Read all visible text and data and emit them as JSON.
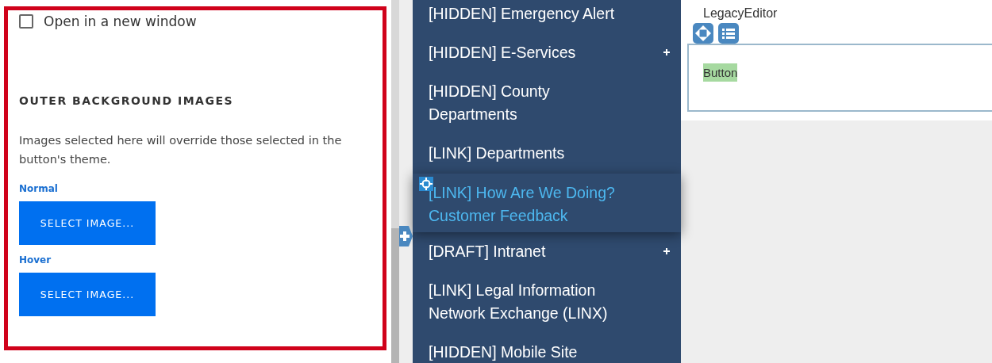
{
  "settings_panel": {
    "open_in_new_window": {
      "label": "Open in a new window",
      "checked": false
    },
    "section_title": "OUTER BACKGROUND IMAGES",
    "description": "Images selected here will override those selected in the button's theme.",
    "image_fields": [
      {
        "label": "Normal",
        "button": "SELECT IMAGE..."
      },
      {
        "label": "Hover",
        "button": "SELECT IMAGE..."
      }
    ]
  },
  "nav_menu": {
    "items": [
      {
        "label": "[HIDDEN] Emergency Alert",
        "has_children": false,
        "selected": false
      },
      {
        "label": "[HIDDEN] E-Services",
        "has_children": true,
        "selected": false
      },
      {
        "label": "[HIDDEN] County Departments",
        "has_children": false,
        "selected": false
      },
      {
        "label": "[LINK] Departments",
        "has_children": false,
        "selected": false
      },
      {
        "label": "[LINK] How Are We Doing? Customer Feedback",
        "has_children": false,
        "selected": true
      },
      {
        "label": "[DRAFT] Intranet",
        "has_children": true,
        "selected": false
      },
      {
        "label": "[LINK] Legal Information Network Exchange (LINX)",
        "has_children": false,
        "selected": false
      },
      {
        "label": "[HIDDEN] Mobile Site",
        "has_children": false,
        "selected": false
      }
    ]
  },
  "editor": {
    "label": "LegacyEditor",
    "content_button": "Button"
  }
}
